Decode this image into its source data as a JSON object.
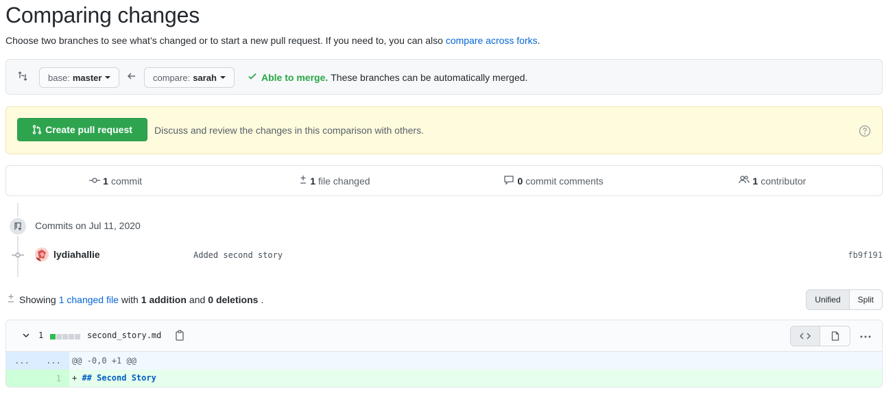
{
  "page": {
    "title": "Comparing changes",
    "subtitle": "Choose two branches to see what’s changed or to start a new pull request. If you need to, you can also",
    "subtitle_link": "compare across forks",
    "subtitle_end": "."
  },
  "range": {
    "base_prefix": "base:",
    "base_branch": "master",
    "compare_prefix": "compare:",
    "compare_branch": "sarah",
    "merge_ok": "Able to merge.",
    "merge_text": "These branches can be automatically merged."
  },
  "flash": {
    "button_label": "Create pull request",
    "text": "Discuss and review the changes in this comparison with others."
  },
  "summary": {
    "commits_count": "1",
    "commits_label": "commit",
    "files_count": "1",
    "files_label": "file changed",
    "comments_count": "0",
    "comments_label": "commit comments",
    "contributors_count": "1",
    "contributors_label": "contributor"
  },
  "commits": {
    "date_heading": "Commits on Jul 11, 2020",
    "items": [
      {
        "author": "lydiahallie",
        "message": "Added second story",
        "sha": "fb9f191"
      }
    ]
  },
  "toc": {
    "showing": "Showing",
    "changed_link": "1 changed file",
    "with": "with",
    "additions": "1 addition",
    "and": "and",
    "deletions": "0 deletions",
    "end": "."
  },
  "view_toggle": {
    "unified": "Unified",
    "split": "Split",
    "selected": "Unified"
  },
  "file": {
    "diffstat": "1",
    "diffstat_blocks": [
      "added",
      "neutral",
      "neutral",
      "neutral",
      "neutral"
    ],
    "name": "second_story.md",
    "hunk": {
      "left_ln": "...",
      "right_ln": "...",
      "header": "@@ -0,0 +1 @@"
    },
    "lines": [
      {
        "new_ln": "1",
        "prefix": "+ ",
        "content": "## Second Story"
      }
    ]
  },
  "colors": {
    "accent_green": "#2ea44f",
    "link_blue": "#0366d6",
    "flash_bg": "#fffbdd",
    "add_bg": "#e6ffed",
    "hunk_bg": "#f1f8ff"
  },
  "icons": [
    "git-compare-icon",
    "arrow-left-icon",
    "check-icon",
    "git-pull-request-icon",
    "question-icon",
    "git-commit-icon",
    "diff-icon",
    "comment-icon",
    "people-icon",
    "repo-push-icon",
    "chevron-down-icon",
    "clippy-icon",
    "code-icon",
    "file-icon",
    "kebab-horizontal-icon"
  ]
}
